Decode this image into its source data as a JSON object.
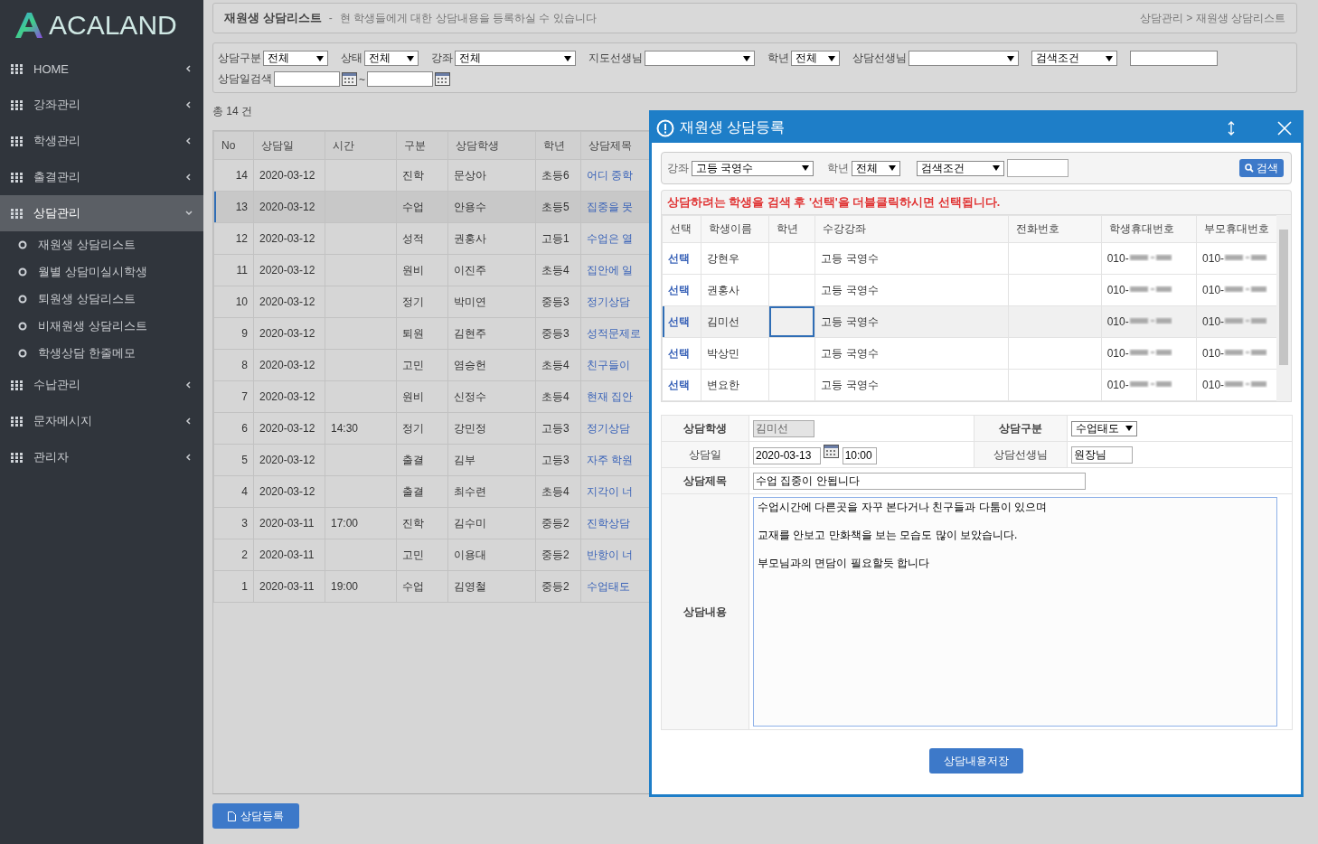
{
  "sidebar": {
    "logo": "ACALAND",
    "items": [
      {
        "label": "HOME",
        "selected": false,
        "expanded": false
      },
      {
        "label": "강좌관리",
        "selected": false,
        "expanded": false
      },
      {
        "label": "학생관리",
        "selected": false,
        "expanded": false
      },
      {
        "label": "출결관리",
        "selected": false,
        "expanded": false
      },
      {
        "label": "상담관리",
        "selected": true,
        "expanded": true,
        "children": [
          {
            "label": "재원생 상담리스트"
          },
          {
            "label": "월별 상담미실시학생"
          },
          {
            "label": "퇴원생 상담리스트"
          },
          {
            "label": "비재원생 상담리스트"
          },
          {
            "label": "학생상담 한줄메모"
          }
        ]
      },
      {
        "label": "수납관리",
        "selected": false,
        "expanded": false
      },
      {
        "label": "문자메시지",
        "selected": false,
        "expanded": false
      },
      {
        "label": "관리자",
        "selected": false,
        "expanded": false
      }
    ]
  },
  "header": {
    "title": "재원생 상담리스트",
    "separator": "-",
    "description": "현 학생들에게 대한 상담내용을 등록하실 수 있습니다",
    "breadcrumb": "상담관리 > 재원생 상담리스트"
  },
  "filters": [
    {
      "kind": "select",
      "label": "상담구분",
      "value": "전체"
    },
    {
      "kind": "select",
      "label": "상태",
      "value": "전체"
    },
    {
      "kind": "select",
      "label": "강좌",
      "value": "전체"
    },
    {
      "kind": "select",
      "label": "지도선생님"
    },
    {
      "kind": "select",
      "label": "학년",
      "value": "전체"
    },
    {
      "kind": "select",
      "label": "상담선생님"
    },
    {
      "kind": "select",
      "value": "검색조건"
    },
    {
      "kind": "text"
    }
  ],
  "date_filter": {
    "label": "상담일검색",
    "separator": "~"
  },
  "total": "총 14 건",
  "table": {
    "columns": [
      "No",
      "상담일",
      "시간",
      "구분",
      "상담학생",
      "학년",
      "상담제목"
    ],
    "rows": [
      {
        "cells": [
          "14",
          "2020-03-12",
          "",
          "진학",
          "문상아",
          "초등6",
          "어디 중학"
        ],
        "selected": false
      },
      {
        "cells": [
          "13",
          "2020-03-12",
          "",
          "수업",
          "안용수",
          "초등5",
          "집중을 못"
        ],
        "selected": true
      },
      {
        "cells": [
          "12",
          "2020-03-12",
          "",
          "성적",
          "권홍사",
          "고등1",
          "수업은 열"
        ],
        "selected": false
      },
      {
        "cells": [
          "11",
          "2020-03-12",
          "",
          "원비",
          "이진주",
          "초등4",
          "집안에 일"
        ],
        "selected": false
      },
      {
        "cells": [
          "10",
          "2020-03-12",
          "",
          "정기",
          "박미연",
          "중등3",
          "정기상담"
        ],
        "selected": false
      },
      {
        "cells": [
          "9",
          "2020-03-12",
          "",
          "퇴원",
          "김현주",
          "중등3",
          "성적문제로"
        ],
        "selected": false
      },
      {
        "cells": [
          "8",
          "2020-03-12",
          "",
          "고민",
          "염승헌",
          "초등4",
          "친구들이"
        ],
        "selected": false
      },
      {
        "cells": [
          "7",
          "2020-03-12",
          "",
          "원비",
          "신정수",
          "초등4",
          "현재 집안"
        ],
        "selected": false
      },
      {
        "cells": [
          "6",
          "2020-03-12",
          "14:30",
          "정기",
          "강민정",
          "고등3",
          "정기상담"
        ],
        "selected": false
      },
      {
        "cells": [
          "5",
          "2020-03-12",
          "",
          "출결",
          "김부",
          "고등3",
          "자주 학원"
        ],
        "selected": false
      },
      {
        "cells": [
          "4",
          "2020-03-12",
          "",
          "출결",
          "최수련",
          "초등4",
          "지각이 너"
        ],
        "selected": false
      },
      {
        "cells": [
          "3",
          "2020-03-11",
          "17:00",
          "진학",
          "김수미",
          "중등2",
          "진학상담"
        ],
        "selected": false
      },
      {
        "cells": [
          "2",
          "2020-03-11",
          "",
          "고민",
          "이용대",
          "중등2",
          "반항이 너"
        ],
        "selected": false
      },
      {
        "cells": [
          "1",
          "2020-03-11",
          "19:00",
          "수업",
          "김영철",
          "중등2",
          "수업태도"
        ],
        "selected": false
      }
    ]
  },
  "register_button": "상담등록",
  "modal": {
    "title": "재원생 상담등록",
    "search": {
      "course_label": "강좌",
      "course": "고등 국영수",
      "grade_label": "학년",
      "grade": "전체",
      "condition": "검색조건",
      "button": "검색"
    },
    "notice": "상담하려는 학생을 검색 후 '선택'을 더블클릭하시면 선택됩니다.",
    "students": {
      "columns": [
        "선택",
        "학생이름",
        "학년",
        "수강강좌",
        "전화번호",
        "학생휴대번호",
        "부모휴대번호"
      ],
      "rows": [
        {
          "action": "선택",
          "name": "강현우",
          "course": "고등 국영수",
          "student_phone": "010-",
          "parent_phone": "010-",
          "selected": false
        },
        {
          "action": "선택",
          "name": "권홍사",
          "course": "고등 국영수",
          "student_phone": "010-",
          "parent_phone": "010-",
          "selected": false
        },
        {
          "action": "선택",
          "name": "김미선",
          "course": "고등 국영수",
          "student_phone": "010-",
          "parent_phone": "010-",
          "selected": true
        },
        {
          "action": "선택",
          "name": "박상민",
          "course": "고등 국영수",
          "student_phone": "010-",
          "parent_phone": "010-",
          "selected": false
        },
        {
          "action": "선택",
          "name": "변요한",
          "course": "고등 국영수",
          "student_phone": "010-",
          "parent_phone": "010-",
          "selected": false
        }
      ]
    },
    "form": {
      "student_label": "상담학생",
      "student": "김미선",
      "type_label": "상담구분",
      "type": "수업태도",
      "date_label": "상담일",
      "date": "2020-03-13",
      "time": "10:00",
      "teacher_label": "상담선생님",
      "teacher": "원장님",
      "subject_label": "상담제목",
      "subject": "수업 집중이 안됩니다",
      "content_label": "상담내용",
      "content": "수업시간에 다른곳을 자꾸 본다거나 친구들과 다툼이 있으며\n\n교재를 안보고 만화책을 보는 모습도 많이 보았습니다.\n\n부모님과의 면담이 필요할듯 합니다"
    },
    "save_button": "상담내용저장"
  }
}
